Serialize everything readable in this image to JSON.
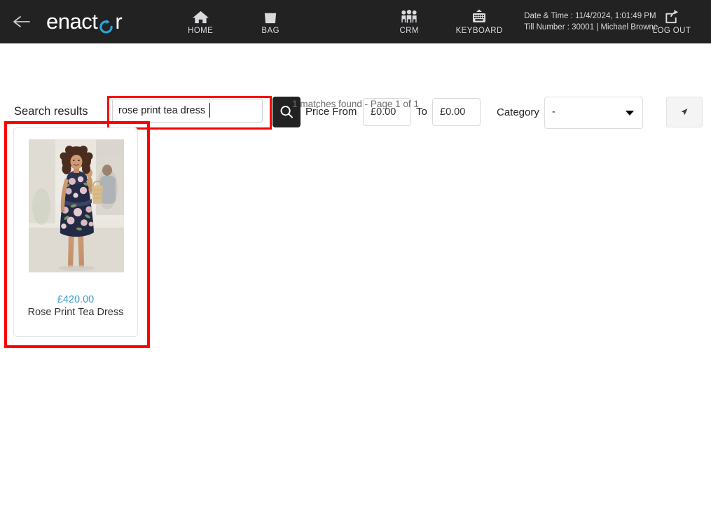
{
  "header": {
    "back_icon": "arrow-left-icon",
    "logo_text_before": "enact",
    "logo_text_after": "r",
    "logo_accent_color": "#27a7df",
    "nav": [
      {
        "label": "HOME",
        "icon": "home-icon"
      },
      {
        "label": "BAG",
        "icon": "bag-icon"
      },
      {
        "label": "CRM",
        "icon": "people-icon"
      },
      {
        "label": "KEYBOARD",
        "icon": "keyboard-icon"
      },
      {
        "label": "LOG OUT",
        "icon": "logout-icon"
      }
    ],
    "datetime_line": "Date & Time : 11/4/2024, 1:01:49 PM",
    "till_line": "Till Number : 30001  |  Michael Browne"
  },
  "search": {
    "label": "Search results",
    "query": "rose print tea dress",
    "placeholder": "",
    "search_icon": "search-icon",
    "highlight_color": "#ff0000"
  },
  "filters": {
    "price_label": "Price  From",
    "price_from": "£0.00",
    "price_to": "£0.00",
    "to_label": "To",
    "category_label": "Category",
    "category_value": "-",
    "action_icon": "cursor-arrow-icon"
  },
  "results": {
    "summary": "1 matches found - Page 1 of 1",
    "items": [
      {
        "price": "£420.00",
        "name": "Rose Print Tea Dress",
        "price_color": "#3b9cd0",
        "image_alt": "woman-in-navy-floral-tea-dress"
      }
    ]
  }
}
